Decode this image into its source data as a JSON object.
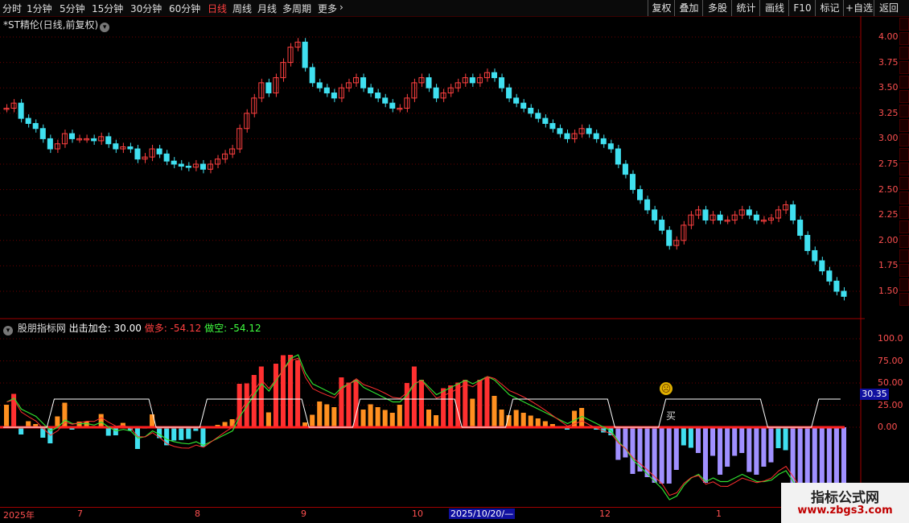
{
  "toolbar": {
    "timeframes": [
      "分时",
      "1分钟",
      "5分钟",
      "15分钟",
      "30分钟",
      "60分钟",
      "日线",
      "周线",
      "月线",
      "多周期",
      "更多"
    ],
    "active_timeframe": "日线",
    "buttons": [
      "复权",
      "叠加",
      "多股",
      "统计",
      "画线",
      "F10",
      "标记",
      "+自选",
      "返回"
    ]
  },
  "stock": {
    "title": "*ST精伦(日线,前复权)"
  },
  "price_axis": [
    "4.00",
    "3.75",
    "3.50",
    "3.25",
    "3.00",
    "2.75",
    "2.50",
    "2.25",
    "2.00",
    "1.75",
    "1.50"
  ],
  "indicator": {
    "name": "股朋指标网",
    "line1": "出击加仓: 30.00",
    "line2": "做多: -54.12",
    "line3": "做空: -54.12",
    "axis": [
      "100.0",
      "75.00",
      "50.00",
      "25.00",
      "0.00"
    ],
    "current_value": "30.35",
    "buy_label": "买",
    "sad_icon": "sad-face-icon"
  },
  "date_axis": [
    "2025年",
    "7",
    "8",
    "9",
    "10",
    "2025/10/20/—",
    "12",
    "1"
  ],
  "watermark": {
    "line1": "指标公式网",
    "line2": "www.zbgs3.com"
  },
  "colors": {
    "up": "#ff4040",
    "down": "#40e0f0",
    "grid": "#6a0000",
    "signal": "#ffffff"
  },
  "chart_data": {
    "type": "candlestick",
    "ylim": [
      1.4,
      4.1
    ],
    "closes": [
      3.3,
      3.35,
      3.2,
      3.15,
      3.1,
      3.0,
      2.9,
      2.95,
      3.05,
      3.0,
      3.0,
      3.0,
      2.98,
      3.02,
      2.95,
      2.9,
      2.92,
      2.9,
      2.8,
      2.82,
      2.9,
      2.85,
      2.78,
      2.75,
      2.73,
      2.72,
      2.75,
      2.7,
      2.75,
      2.8,
      2.85,
      2.9,
      3.1,
      3.25,
      3.4,
      3.55,
      3.45,
      3.6,
      3.75,
      3.9,
      3.95,
      3.7,
      3.55,
      3.5,
      3.45,
      3.4,
      3.5,
      3.55,
      3.6,
      3.5,
      3.45,
      3.4,
      3.35,
      3.3,
      3.3,
      3.4,
      3.55,
      3.6,
      3.5,
      3.4,
      3.45,
      3.5,
      3.55,
      3.6,
      3.55,
      3.6,
      3.65,
      3.6,
      3.5,
      3.4,
      3.35,
      3.3,
      3.25,
      3.2,
      3.15,
      3.1,
      3.05,
      3.0,
      3.05,
      3.1,
      3.05,
      3.0,
      2.95,
      2.9,
      2.75,
      2.65,
      2.5,
      2.4,
      2.3,
      2.2,
      2.1,
      1.95,
      2.0,
      2.15,
      2.25,
      2.3,
      2.2,
      2.25,
      2.2,
      2.2,
      2.25,
      2.3,
      2.25,
      2.2,
      2.2,
      2.22,
      2.3,
      2.35,
      2.2,
      2.05,
      1.9,
      1.8,
      1.7,
      1.6,
      1.5,
      1.45
    ]
  }
}
